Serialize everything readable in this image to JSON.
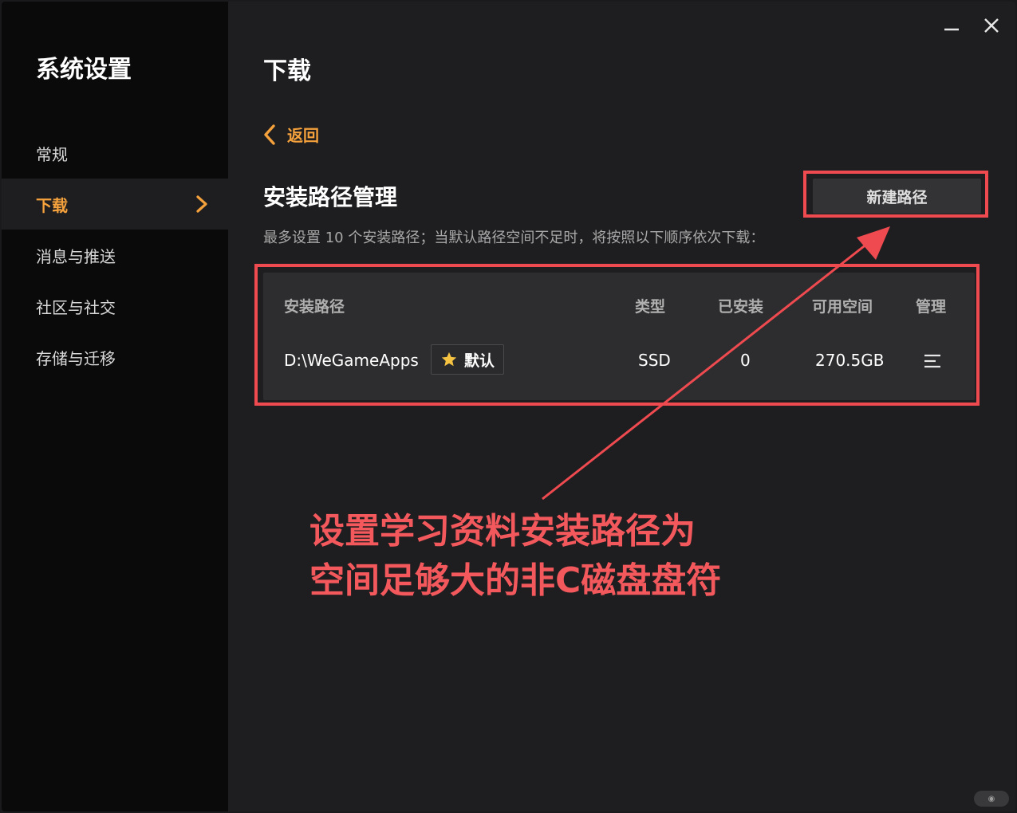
{
  "sidebar": {
    "title": "系统设置",
    "items": [
      {
        "label": "常规",
        "active": false
      },
      {
        "label": "下载",
        "active": true
      },
      {
        "label": "消息与推送",
        "active": false
      },
      {
        "label": "社区与社交",
        "active": false
      },
      {
        "label": "存储与迁移",
        "active": false
      }
    ]
  },
  "window_controls": {
    "minimize_icon": "minimize-icon",
    "close_icon": "close-icon"
  },
  "main": {
    "page_title": "下载",
    "back_label": "返回",
    "section_title": "安装路径管理",
    "new_path_button": "新建路径",
    "hint": "最多设置 10 个安装路径；当默认路径空间不足时，将按照以下顺序依次下载：",
    "table": {
      "headers": {
        "path": "安装路径",
        "type": "类型",
        "installed": "已安装",
        "free_space": "可用空间",
        "manage": "管理"
      },
      "rows": [
        {
          "path": "D:\\WeGameApps",
          "badge": "默认",
          "type": "SSD",
          "installed": "0",
          "free_space": "270.5GB"
        }
      ]
    }
  },
  "annotation": {
    "line1": "设置学习资料安装路径为",
    "line2": "空间足够大的非C磁盘盘符",
    "color": "#ee4a4f"
  },
  "colors": {
    "accent": "#f5a13c",
    "sidebar_bg": "#0a0a0b",
    "panel_bg": "#1e1e20"
  }
}
